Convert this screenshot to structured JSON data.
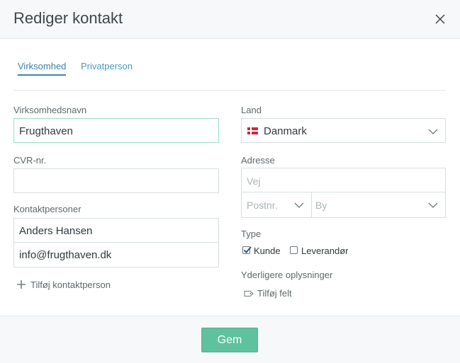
{
  "dialog": {
    "title": "Rediger kontakt",
    "close_icon": "close-icon"
  },
  "tabs": [
    {
      "label": "Virksomhed",
      "active": true
    },
    {
      "label": "Privatperson",
      "active": false
    }
  ],
  "left": {
    "company_name_label": "Virksomhedsnavn",
    "company_name_value": "Frugthaven",
    "cvr_label": "CVR-nr.",
    "cvr_value": "",
    "contacts_label": "Kontaktpersoner",
    "contact_name": "Anders Hansen",
    "contact_email": "info@frugthaven.dk",
    "add_contact_label": "Tilføj kontaktperson"
  },
  "right": {
    "country_label": "Land",
    "country_value": "Danmark",
    "address_label": "Adresse",
    "street_placeholder": "Vej",
    "postal_placeholder": "Postnr.",
    "city_placeholder": "By",
    "type_label": "Type",
    "type_options": [
      {
        "label": "Kunde",
        "checked": true
      },
      {
        "label": "Leverandør",
        "checked": false
      }
    ],
    "extra_label": "Yderligere oplysninger",
    "add_field_label": "Tilføj felt"
  },
  "footer": {
    "save_label": "Gem"
  },
  "colors": {
    "accent": "#5ec29f",
    "link": "#4a9bc1",
    "focus_border": "#9bdcc7"
  }
}
